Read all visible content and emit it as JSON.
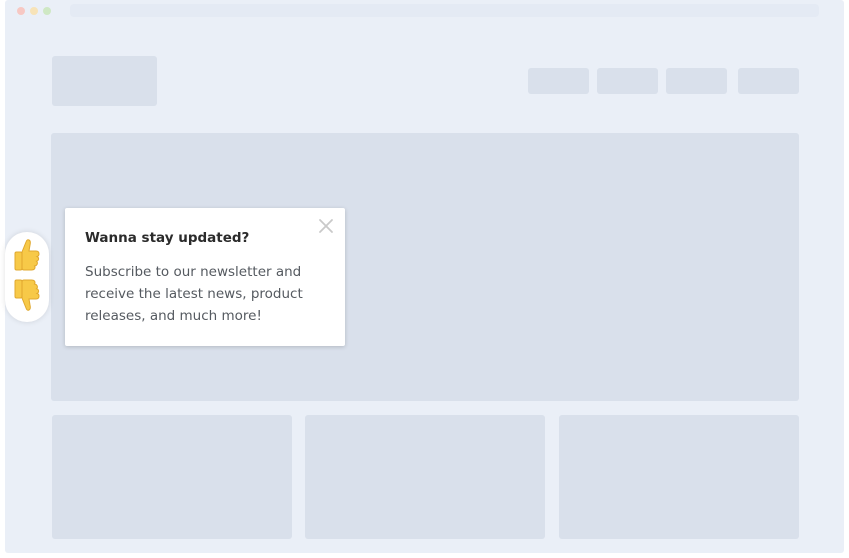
{
  "browser": {
    "window_dots": [
      {
        "name": "close",
        "color": "#f7c8c3"
      },
      {
        "name": "minimize",
        "color": "#f7e3b8"
      },
      {
        "name": "maximize",
        "color": "#cfe8c4"
      }
    ]
  },
  "rating_widget": {
    "up_icon": "thumbs-up-icon",
    "down_icon": "thumbs-down-icon",
    "accent": "#f7c948"
  },
  "popup": {
    "title": "Wanna stay updated?",
    "body": "Subscribe to our newsletter and receive the latest news, product releases, and much more!",
    "close_icon": "close-icon"
  },
  "colors": {
    "page_background": "#eaeff7",
    "placeholder": "#d9e0eb",
    "popup_background": "#ffffff"
  }
}
